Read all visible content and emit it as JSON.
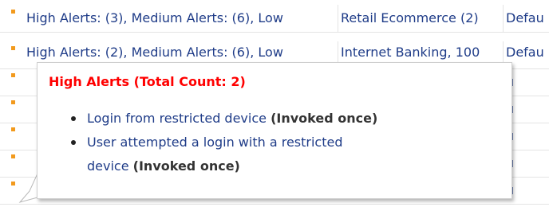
{
  "table": {
    "rows": [
      {
        "alerts": "High Alerts: (3), Medium Alerts: (6), Low",
        "application": "Retail Ecommerce (2)",
        "policy": "Defau"
      },
      {
        "alerts": "High Alerts: (2), Medium Alerts: (6), Low",
        "application": "Internet Banking, 100",
        "policy": "Defau"
      },
      {
        "alerts": "",
        "application": "",
        "policy": "u"
      },
      {
        "alerts": "",
        "application": "",
        "policy": "u"
      },
      {
        "alerts": "",
        "application": "",
        "policy": "u"
      },
      {
        "alerts": "",
        "application": "",
        "policy": "u"
      },
      {
        "alerts": "",
        "application": "",
        "policy": "u"
      }
    ]
  },
  "tooltip": {
    "title": "High Alerts (Total Count: 2)",
    "items": [
      {
        "text_line1": "Login from restricted device",
        "text_line2": "",
        "invoked": "(Invoked once)"
      },
      {
        "text_line1": "User attempted a login with a restricted",
        "text_line2": "device",
        "invoked": "(Invoked once)"
      }
    ]
  },
  "colors": {
    "marker": "#f29a1d",
    "title": "#ff0000",
    "text": "#1f3c88"
  }
}
